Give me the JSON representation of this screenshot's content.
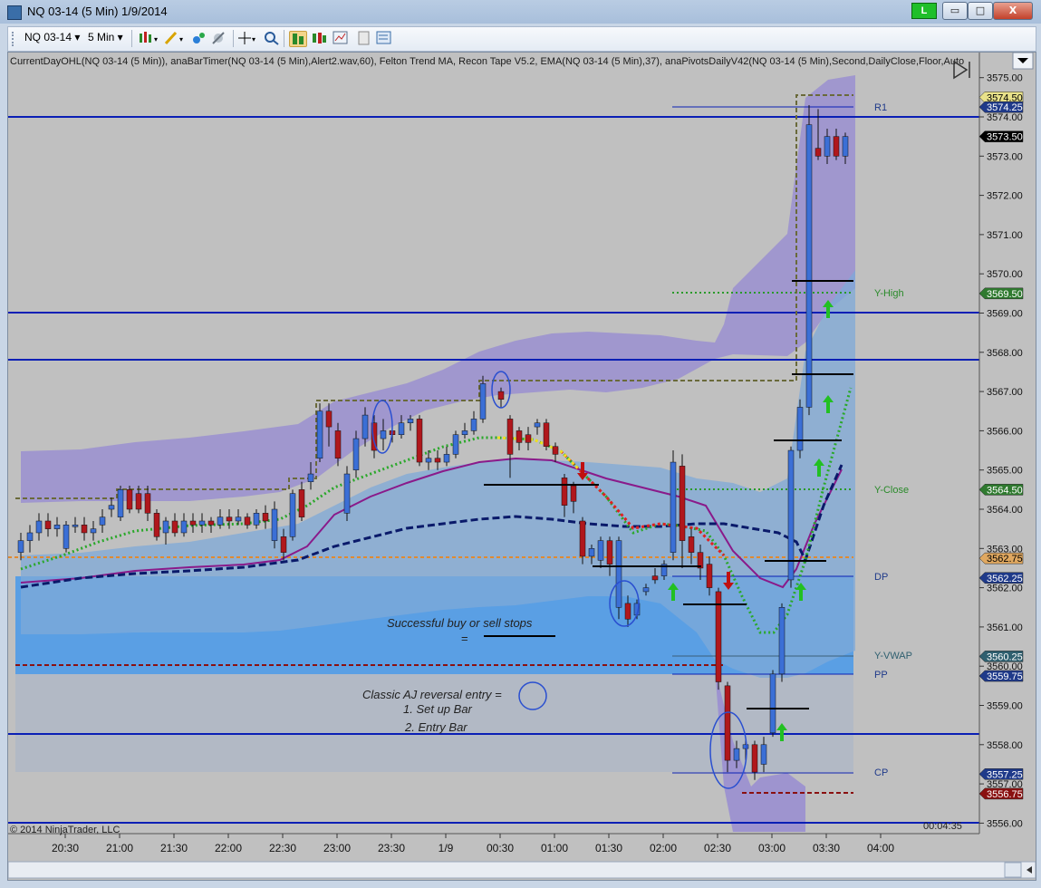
{
  "window": {
    "title": "NQ 03-14 (5 Min)  1/9/2014",
    "live_badge": "L",
    "minimize_glyph": "▭",
    "maximize_glyph": "□",
    "close_glyph": "X"
  },
  "toolbar": {
    "instrument": "NQ 03-14",
    "interval": "5 Min"
  },
  "chart": {
    "indicators_line": "CurrentDayOHL(NQ 03-14 (5 Min)), anaBarTimer(NQ 03-14 (5 Min),Alert2.wav,60), Felton Trend MA, Recon Tape V5.2, EMA(NQ 03-14 (5 Min),37), anaPivotsDailyV42(NQ 03-14 (5 Min),Second,DailyClose,Floor,Auto",
    "copyright": "© 2014 NinjaTrader, LLC",
    "bar_timer": "00:04:35",
    "annotation_stops_line1": "Successful buy or sell stops",
    "annotation_stops_line2": "=",
    "annotation_aj_line1": "Classic AJ reversal entry =",
    "annotation_aj_line2": "1. Set up Bar",
    "annotation_aj_line3": "2. Entry Bar",
    "pivot_labels": [
      "R1",
      "Y-High",
      "Y-Close",
      "DP",
      "Y-VWAP",
      "PP",
      "CP"
    ],
    "y_axis_ticks": [
      "3575.00",
      "3574.00",
      "3573.00",
      "3572.00",
      "3571.00",
      "3570.00",
      "3569.00",
      "3568.00",
      "3567.00",
      "3566.00",
      "3565.00",
      "3564.00",
      "3563.00",
      "3562.00",
      "3561.00",
      "3560.00",
      "3559.00",
      "3558.00",
      "3557.00",
      "3556.00"
    ],
    "price_flags": [
      {
        "text": "3574.50",
        "bg": "#e9e28a",
        "fg": "#000000"
      },
      {
        "text": "3574.25",
        "bg": "#1f3a8a",
        "fg": "#ffffff"
      },
      {
        "text": "3573.50",
        "bg": "#000000",
        "fg": "#ffffff"
      },
      {
        "text": "3569.50",
        "bg": "#2f7a2f",
        "fg": "#ffffff"
      },
      {
        "text": "3564.50",
        "bg": "#2f7a2f",
        "fg": "#ffffff"
      },
      {
        "text": "3562.75",
        "bg": "#e0a860",
        "fg": "#000000"
      },
      {
        "text": "3562.25",
        "bg": "#1f3a8a",
        "fg": "#ffffff"
      },
      {
        "text": "3560.25",
        "bg": "#2f5f6f",
        "fg": "#ffffff"
      },
      {
        "text": "3559.75",
        "bg": "#1f3a8a",
        "fg": "#ffffff"
      },
      {
        "text": "3557.25",
        "bg": "#1f3a8a",
        "fg": "#ffffff"
      },
      {
        "text": "3556.75",
        "bg": "#8a1010",
        "fg": "#ffffff"
      }
    ],
    "x_axis_ticks": [
      "20:30",
      "21:00",
      "21:30",
      "22:00",
      "22:30",
      "23:00",
      "23:30",
      "1/9",
      "00:30",
      "01:00",
      "01:30",
      "02:00",
      "02:30",
      "03:00",
      "03:30",
      "04:00"
    ],
    "colors": {
      "up_candle": "#3b6fd6",
      "down_candle": "#b0171c",
      "pivot_line": "#0a1fb5",
      "band_fill": "#9a8fd0",
      "value_zone": "#4f9be8"
    }
  }
}
